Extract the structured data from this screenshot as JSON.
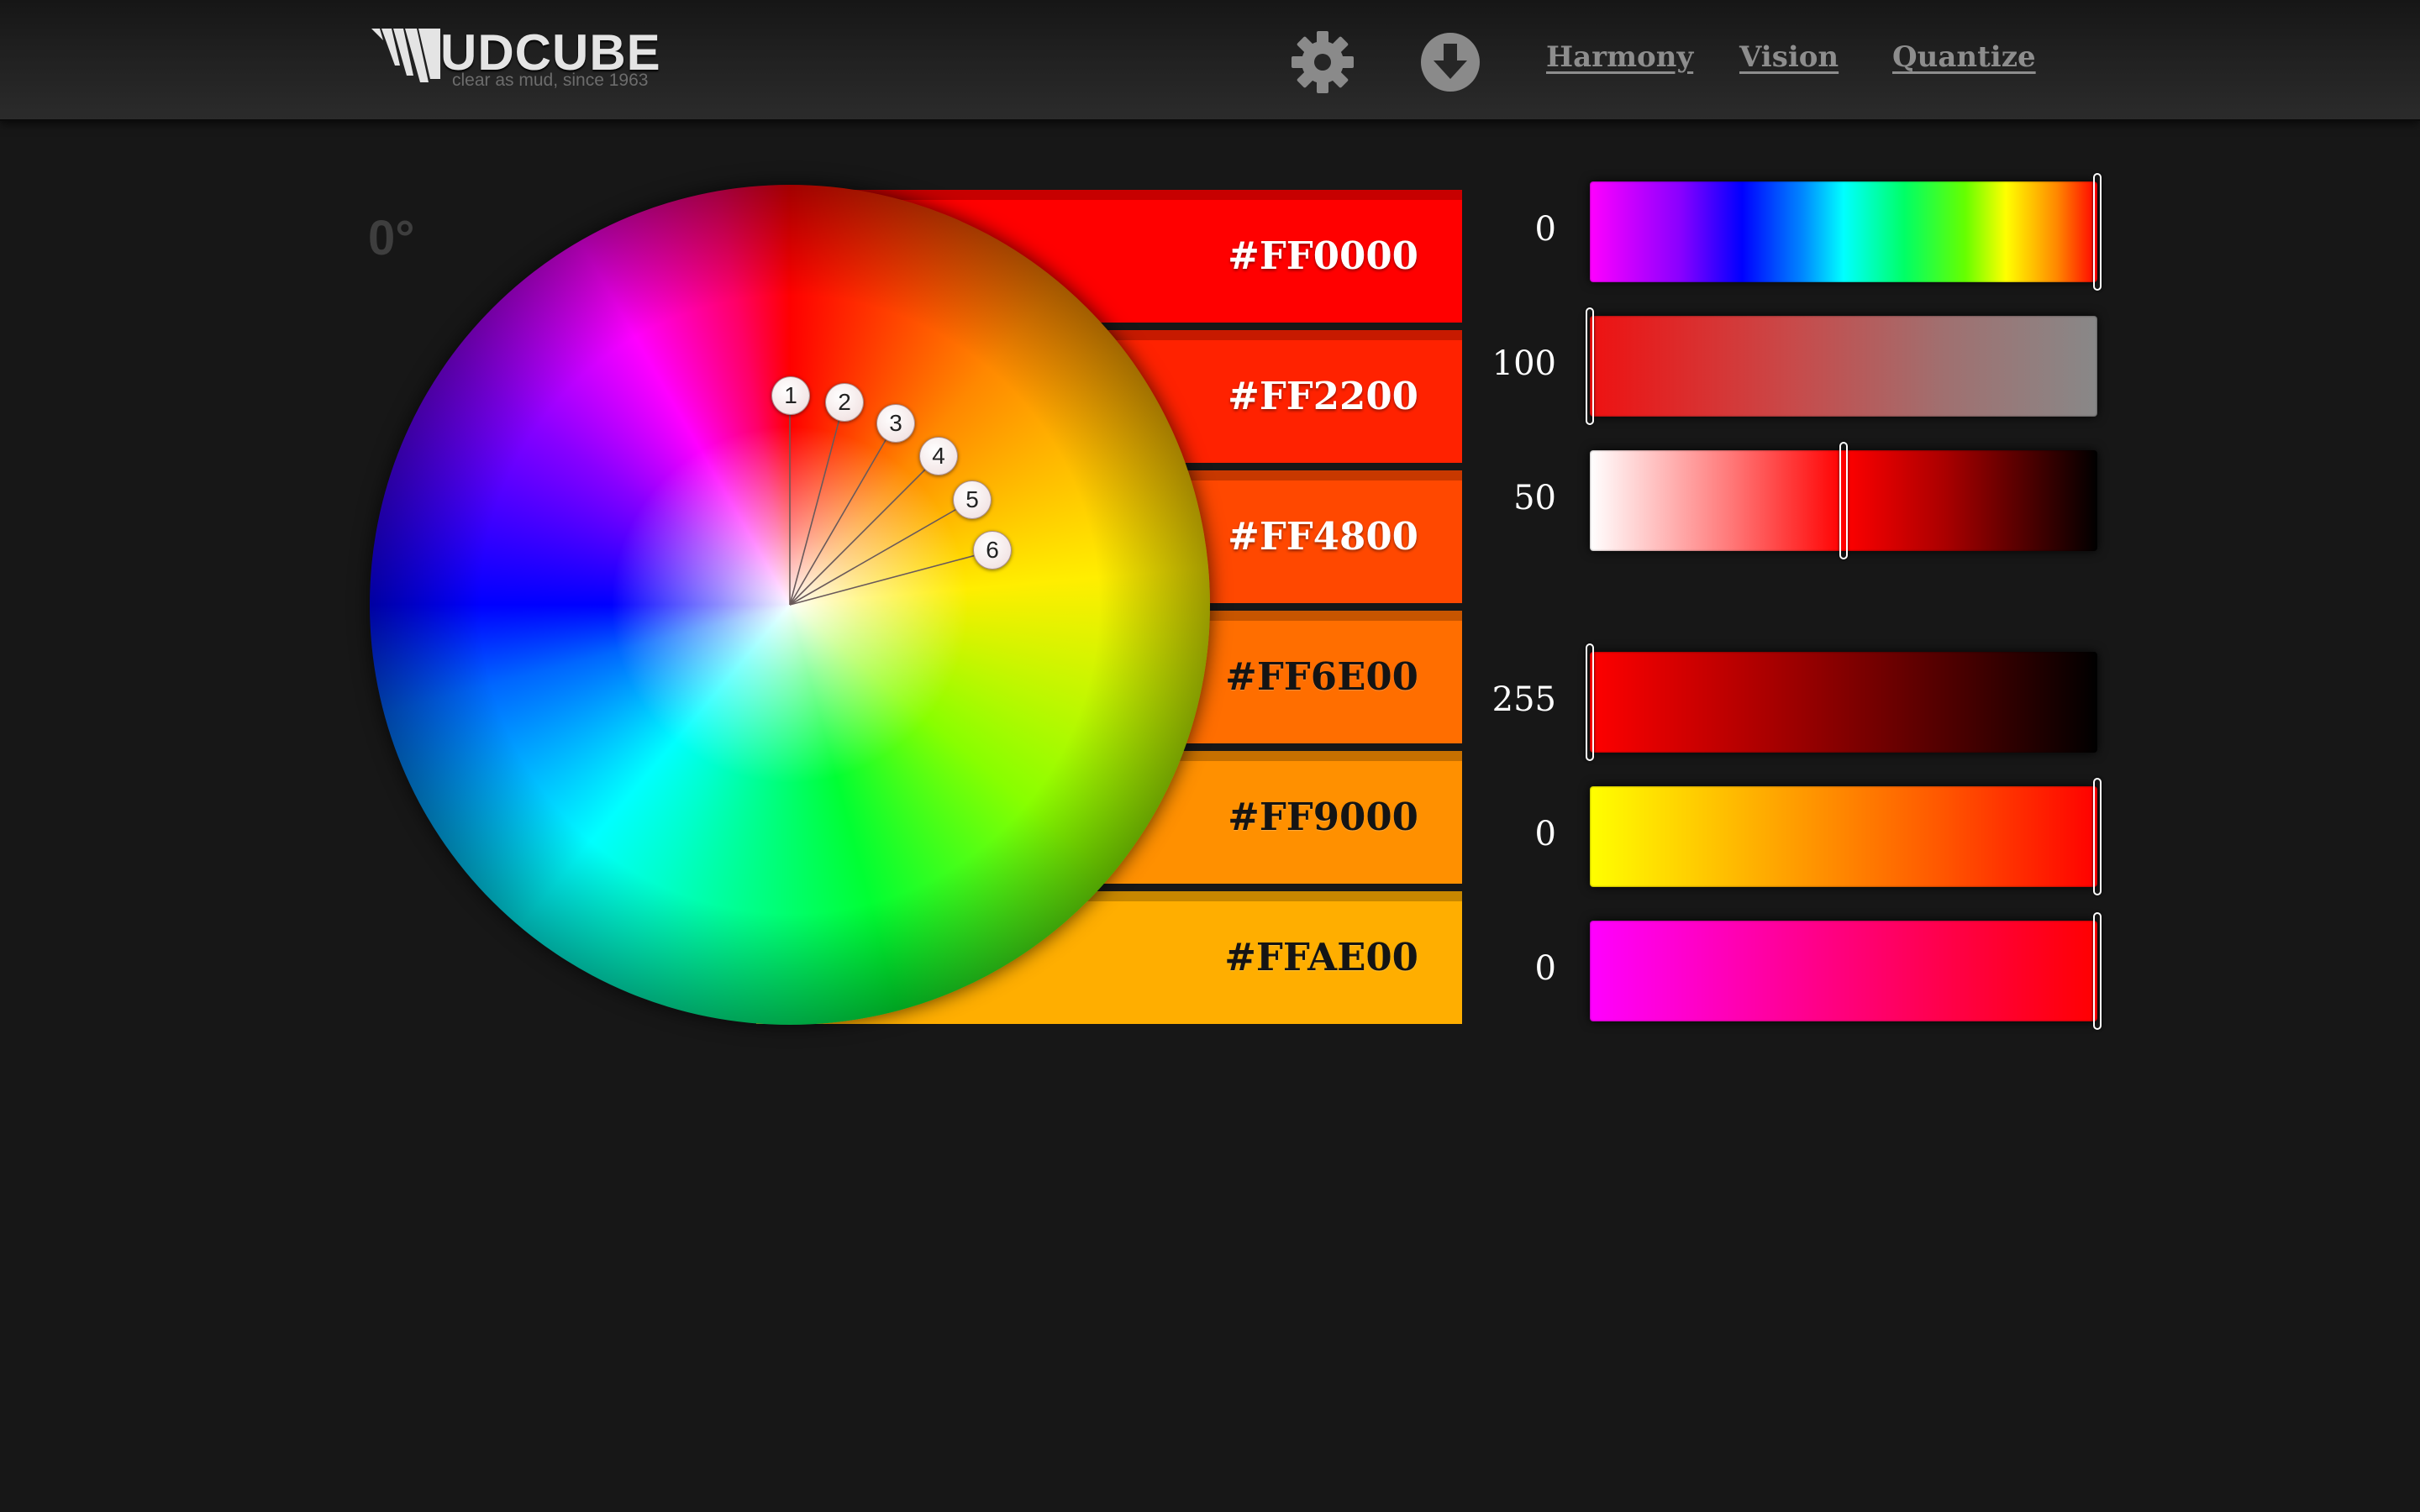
{
  "header": {
    "logo": {
      "wordmark": "UDCUBE",
      "tagline": "clear as mud, since 1963"
    },
    "icons": [
      "gear-icon",
      "download-icon"
    ],
    "nav": [
      {
        "label": "Harmony"
      },
      {
        "label": "Vision"
      },
      {
        "label": "Quantize"
      }
    ]
  },
  "wheel": {
    "angle_label": "0°",
    "markers": [
      "1",
      "2",
      "3",
      "4",
      "5",
      "6"
    ]
  },
  "swatches": [
    {
      "hex": "#FF0000",
      "color": "#FF0000"
    },
    {
      "hex": "#FF2200",
      "color": "#FF2200"
    },
    {
      "hex": "#FF4800",
      "color": "#FF4800"
    },
    {
      "hex": "#FF6E00",
      "color": "#FF6E00"
    },
    {
      "hex": "#FF9000",
      "color": "#FF9000"
    },
    {
      "hex": "#FFAE00",
      "color": "#FFAE00"
    }
  ],
  "sliders": [
    {
      "value": "0",
      "fraction": 1.0
    },
    {
      "value": "100",
      "fraction": 0.0
    },
    {
      "value": "50",
      "fraction": 0.5
    },
    {
      "value": "255",
      "fraction": 0.0
    },
    {
      "value": "0",
      "fraction": 1.0
    },
    {
      "value": "0",
      "fraction": 1.0
    }
  ]
}
